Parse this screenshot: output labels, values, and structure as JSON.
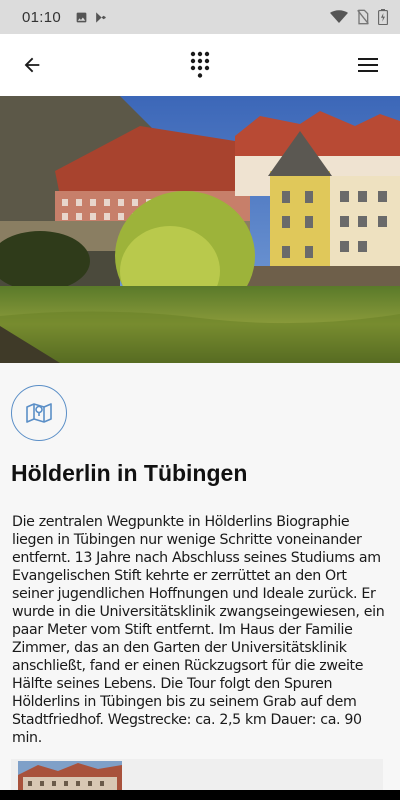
{
  "status_bar": {
    "time": "01:10",
    "left_icons": [
      "image-icon",
      "play-store-icon"
    ],
    "right_icons": [
      "wifi-icon",
      "no-sim-icon",
      "battery-icon"
    ]
  },
  "app_bar": {
    "back_icon": "arrow-left-icon",
    "center_icon": "dialpad-icon",
    "menu_icon": "hamburger-menu-icon"
  },
  "hero": {
    "icon": "photo-tuebingen-riverfront"
  },
  "content": {
    "badge_icon": "map-icon",
    "title": "Hölderlin in Tübingen",
    "description": "Die zentralen Wegpunkte in Hölderlins Biographie liegen in Tübingen nur wenige Schritte voneinander entfernt. 13 Jahre nach Abschluss seines Studiums am Evangelischen Stift kehrte er zerrüttet an den Ort seiner jugendlichen Hoffnungen und Ideale zurück. Er wurde in die Universitätsklinik zwangseingewiesen, ein paar Meter vom Stift entfernt. Im Haus der Familie Zimmer, das an den Garten der Universitätsklinik anschließt, fand er einen Rückzugsort für die zweite Hälfte seines Lebens. Die Tour folgt den Spuren Hölderlins in Tübingen bis zu seinem Grab auf dem Stadtfriedhof. Wegstrecke: ca. 2,5 km Dauer: ca. 90 min."
  },
  "colors": {
    "accent": "#5b8fc7",
    "status_bar": "#dcdcdc",
    "content_bg": "#f7f7f7"
  }
}
